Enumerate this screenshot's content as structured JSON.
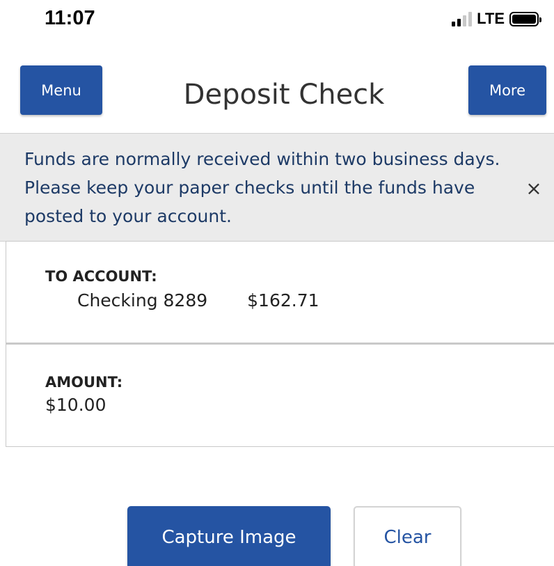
{
  "status_bar": {
    "time": "11:07",
    "network": "LTE",
    "signal_bars_filled": 2,
    "signal_bars_total": 4,
    "icons": [
      "signal-icon",
      "battery-icon"
    ]
  },
  "header": {
    "menu_label": "Menu",
    "title": "Deposit Check",
    "more_label": "More"
  },
  "notice": {
    "text": "Funds are normally received within two business days. Please keep your paper checks until the funds have posted to your account.",
    "close_glyph": "×",
    "close_icon": "close-icon"
  },
  "to_account": {
    "label": "TO ACCOUNT:",
    "account_name": "Checking 8289",
    "balance": "$162.71"
  },
  "amount": {
    "label": "AMOUNT:",
    "value": "$10.00"
  },
  "actions": {
    "capture_label": "Capture Image",
    "clear_label": "Clear"
  },
  "colors": {
    "primary": "#2554a3",
    "notice_background": "#ebebeb",
    "notice_text": "#1d3a66"
  }
}
